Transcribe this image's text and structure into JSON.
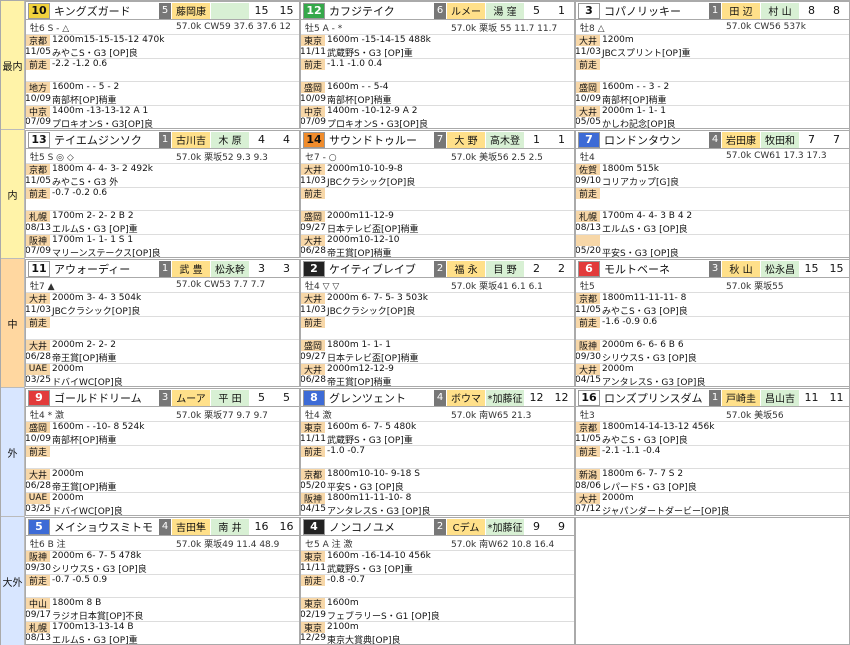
{
  "bands": [
    {
      "label": "最内",
      "color": "#fff3a8"
    },
    {
      "label": "内",
      "color": "#fff3a8"
    },
    {
      "label": "中",
      "color": "#ffd7a0"
    },
    {
      "label": "外",
      "color": "#d8e6ff"
    },
    {
      "label": "大外",
      "color": "#d8e6ff"
    }
  ],
  "cards": [
    {
      "no": "10",
      "name": "キングズガード",
      "frame": "5",
      "jockey": "藤岡康",
      "trainer": "",
      "n1": "15",
      "n2": "15",
      "sub": "牡6  S - △",
      "sub2": "57.0k CW59  37.6  37.6  12",
      "left": [
        "京都 1200m15-15-15-12 470k",
        "11/05 みやこS・G3 [OP]良",
        "前走 -2.2 -1.2 0.6",
        "",
        "地方 1600m -  -  5 - 2",
        "10/09 南部杯[OP]稍重",
        "中京 1400m -13-13-12 A 1",
        "07/09 プロキオンS・G3[OP]良"
      ]
    },
    {
      "no": "12",
      "name": "カフジテイク",
      "frame": "6",
      "jockey": "ルメー",
      "trainer": "湯 窪",
      "n1": "5",
      "n2": "1",
      "sub": "牡5  A - *",
      "sub2": "57.0k 栗坂  55  11.7  11.7",
      "left": [
        "東京 1600m -15-14-15 488k",
        "11/11 武蔵野S・G3 [OP]重",
        "前走 -1.1 -1.0 0.4",
        "",
        "盛岡 1600m -  -  5-4",
        "10/09 南部杯[OP]稍重",
        "中京 1400m -10-12-9 A 2",
        "07/09 プロキオンS・G3[OP]良"
      ]
    },
    {
      "no": "3",
      "name": "コパノリッキー",
      "frame": "1",
      "jockey": "田 辺",
      "trainer": "村 山",
      "n1": "8",
      "n2": "8",
      "sub": "牡8  △",
      "sub2": "57.0k CW56  537k",
      "left": [
        "大井 1200m",
        "11/03 JBCスプリント[OP]重",
        "前走",
        "",
        "盛岡 1600m -  -  3 - 2",
        "10/09 南部杯[OP]稍重",
        "大井 2000m  1-  1-  1",
        "05/05 かしわ記念[OP]良"
      ]
    },
    {
      "no": "13",
      "name": "テイエムジンソク",
      "frame": "1",
      "jockey": "古川吉",
      "trainer": "木 原",
      "n1": "4",
      "n2": "4",
      "sub": "牡5  S ◎ ◇",
      "sub2": "57.0k 栗坂52  9.3  9.3",
      "left": [
        "京都 1800m 4- 4- 3- 2 492k",
        "11/05 みやこS・G3 外",
        "前走 -0.7 -0.2 0.6",
        "",
        "札幌 1700m 2- 2- 2 B 2",
        "08/13 エルムS・G3 [OP]重",
        "阪神 1700m 1- 1- 1 S 1",
        "07/09 マリーンステークス[OP]良"
      ]
    },
    {
      "no": "14",
      "name": "サウンドトゥルー",
      "frame": "7",
      "jockey": "大 野",
      "trainer": "高木登",
      "n1": "1",
      "n2": "1",
      "sub": "セ7  - ○",
      "sub2": "57.0k 美坂56  2.5  2.5",
      "left": [
        "大井 2000m10-10-9-8",
        "11/03 JBCクラシック[OP]良",
        "前走",
        "",
        "盛岡 2000m11-12-9",
        "09/27 日本テレビ盃[OP]稍重",
        "大井 2000m10-12-10",
        "06/28 帝王賞[OP]稍重"
      ]
    },
    {
      "no": "7",
      "name": "ロンドンタウン",
      "frame": "4",
      "jockey": "岩田康",
      "trainer": "牧田和",
      "n1": "7",
      "n2": "7",
      "sub": "牡4",
      "sub2": "57.0k CW61  17.3  17.3",
      "left": [
        "佐賀 1800m 515k",
        "09/10 コリアカップ[G]良",
        "前走",
        "",
        "札幌 1700m 4- 4- 3 B 4 2",
        "08/13 エルムS・G3 [OP]良",
        "",
        "05/20 平安S・G3 [OP]良"
      ]
    },
    {
      "no": "11",
      "name": "アウォーディー",
      "frame": "1",
      "jockey": "武 豊",
      "trainer": "松永幹",
      "n1": "3",
      "n2": "3",
      "sub": "牡7  ▲",
      "sub2": "57.0k CW53  7.7  7.7",
      "left": [
        "大井 2000m 3- 4- 3 504k",
        "11/03 JBCクラシック[OP]良",
        "前走",
        "",
        "大井 2000m 2- 2- 2",
        "06/28 帝王賞[OP]稍重",
        "UAE 2000m",
        "03/25 ドバイWC[OP]良"
      ]
    },
    {
      "no": "2",
      "name": "ケイティブレイブ",
      "frame": "2",
      "jockey": "福 永",
      "trainer": "目 野",
      "n1": "2",
      "n2": "2",
      "sub": "牡4  ▽ ▽",
      "sub2": "57.0k 栗坂41  6.1  6.1",
      "left": [
        "大井 2000m 6- 7- 5- 3 503k",
        "11/03 JBCクラシック[OP]良",
        "前走",
        "",
        "盛岡 1800m 1- 1- 1",
        "09/27 日本テレビ盃[OP]稍重",
        "大井 2000m12-12-9",
        "06/28 帝王賞[OP]稍重"
      ]
    },
    {
      "no": "6",
      "name": "モルトベーネ",
      "frame": "3",
      "jockey": "秋 山",
      "trainer": "松永昌",
      "n1": "15",
      "n2": "15",
      "sub": "牡5",
      "sub2": "57.0k 栗坂55",
      "left": [
        "京都 1800m11-11-11- 8",
        "11/05 みやこS・G3 [OP]良",
        "前走 -1.6 -0.9 0.6",
        "",
        "阪神 2000m 6- 6- 6 B 6",
        "09/30 シリウスS・G3 [OP]良",
        "大井 2000m",
        "04/15 アンタレスS・G3 [OP]良"
      ]
    },
    {
      "no": "9",
      "name": "ゴールドドリーム",
      "frame": "3",
      "jockey": "ムーア",
      "trainer": "平 田",
      "n1": "5",
      "n2": "5",
      "sub": "牡4  * 激",
      "sub2": "57.0k 栗坂77  9.7  9.7",
      "left": [
        "盛岡 1600m -  -10- 8 524k",
        "10/09 南部杯[OP]稍重",
        "前走",
        "",
        "大井 2000m",
        "06/28 帝王賞[OP]稍重",
        "UAE 2000m",
        "03/25 ドバイWC[OP]良"
      ]
    },
    {
      "no": "8",
      "name": "グレンツェント",
      "frame": "4",
      "jockey": "ボウマ",
      "trainer": "*加藤征",
      "n1": "12",
      "n2": "12",
      "sub": "牡4  激",
      "sub2": "57.0k 南W65  21.3",
      "left": [
        "東京 1600m 6- 7- 5 480k",
        "11/11 武蔵野S・G3 [OP]重",
        "前走 -1.0 -0.7",
        "",
        "京都 1800m10-10- 9-18 S",
        "05/20 平安S・G3 [OP]良",
        "阪神 1800m11-11-10- 8",
        "04/15 アンタレスS・G3 [OP]良"
      ]
    },
    {
      "no": "16",
      "name": "ロンズプリンスダム",
      "frame": "1",
      "jockey": "戸崎圭",
      "trainer": "昌山吉",
      "n1": "11",
      "n2": "11",
      "sub": "牡3",
      "sub2": "57.0k 美坂56",
      "left": [
        "京都 1800m14-14-13-12 456k",
        "11/05 みやこS・G3 [OP]良",
        "前走 -2.1 -1.1 -0.4",
        "",
        "新潟 1800m 6- 7- 7 S 2",
        "08/06 レパードS・G3 [OP]良",
        "大井 2000m",
        "07/12 ジャパンダートダービー[OP]良"
      ]
    },
    {
      "no": "5",
      "name": "メイショウスミトモ",
      "frame": "4",
      "jockey": "吉田隼",
      "trainer": "南 井",
      "n1": "16",
      "n2": "16",
      "sub": "牡6  B 注",
      "sub2": "57.0k 栗坂49  11.4  48.9",
      "left": [
        "阪神 2000m 6- 7- 5 478k",
        "09/30 シリウスS・G3 [OP]良",
        "前走 -0.7 -0.5 0.9",
        "",
        "中山 1800m 8 B",
        "09/17 ラジオ日本賞[OP]不良",
        "札幌 1700m13-13-14 B",
        "08/13 エルムS・G3 [OP]重"
      ]
    },
    {
      "no": "4",
      "name": "ノンコノユメ",
      "frame": "2",
      "jockey": "Cデム",
      "trainer": "*加藤征",
      "n1": "9",
      "n2": "9",
      "sub": "セ5  A 注 激",
      "sub2": "57.0k 南W62  10.8  16.4",
      "left": [
        "東京 1600m -16-14-10 456k",
        "11/11 武蔵野S・G3 [OP]重",
        "前走 -0.8 -0.7",
        "",
        "東京 1600m",
        "02/19 フェブラリーS・G1 [OP]良",
        "東京 2100m",
        "12/29 東京大賞典[OP]良"
      ]
    }
  ]
}
